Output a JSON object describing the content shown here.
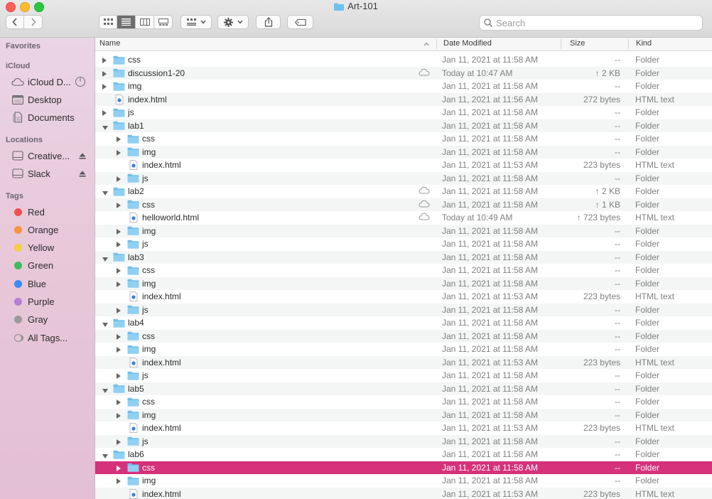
{
  "window": {
    "title": "Art-101",
    "search_placeholder": "Search"
  },
  "colors": {
    "selection": "#d6317b",
    "folder": "#6fc0ec",
    "sidebar_bg": "#e8c8d9"
  },
  "sidebar": {
    "favorites_label": "Favorites",
    "icloud_label": "iCloud",
    "icloud_items": [
      {
        "label": "iCloud D...",
        "icon": "cloud-icon"
      },
      {
        "label": "Desktop",
        "icon": "desktop-icon"
      },
      {
        "label": "Documents",
        "icon": "document-icon"
      }
    ],
    "locations_label": "Locations",
    "locations_items": [
      {
        "label": "Creative...",
        "icon": "drive-icon"
      },
      {
        "label": "Slack",
        "icon": "drive-icon"
      }
    ],
    "tags_label": "Tags",
    "tags": [
      {
        "label": "Red",
        "color": "#f0504f"
      },
      {
        "label": "Orange",
        "color": "#f5963f"
      },
      {
        "label": "Yellow",
        "color": "#f6cf42"
      },
      {
        "label": "Green",
        "color": "#3ebd5b"
      },
      {
        "label": "Blue",
        "color": "#3b8cf3"
      },
      {
        "label": "Purple",
        "color": "#b57ed9"
      },
      {
        "label": "Gray",
        "color": "#9a9a9a"
      },
      {
        "label": "All Tags...",
        "color": "none"
      }
    ]
  },
  "columns": {
    "name": "Name",
    "date": "Date Modified",
    "size": "Size",
    "kind": "Kind"
  },
  "rows": [
    {
      "name": "css",
      "level": 0,
      "type": "folder",
      "disclosure": "closed",
      "date": "Jan 11, 2021 at 11:58 AM",
      "size": "--",
      "kind": "Folder",
      "cloud": false
    },
    {
      "name": "discussion1-20",
      "level": 0,
      "type": "folder",
      "disclosure": "closed",
      "date": "Today at 10:47 AM",
      "size": "↑ 2 KB",
      "kind": "Folder",
      "cloud": true
    },
    {
      "name": "img",
      "level": 0,
      "type": "folder",
      "disclosure": "closed",
      "date": "Jan 11, 2021 at 11:58 AM",
      "size": "--",
      "kind": "Folder",
      "cloud": false
    },
    {
      "name": "index.html",
      "level": 0,
      "type": "file",
      "disclosure": "none",
      "date": "Jan 11, 2021 at 11:56 AM",
      "size": "272 bytes",
      "kind": "HTML text",
      "cloud": false
    },
    {
      "name": "js",
      "level": 0,
      "type": "folder",
      "disclosure": "closed",
      "date": "Jan 11, 2021 at 11:58 AM",
      "size": "--",
      "kind": "Folder",
      "cloud": false
    },
    {
      "name": "lab1",
      "level": 0,
      "type": "folder",
      "disclosure": "open",
      "date": "Jan 11, 2021 at 11:58 AM",
      "size": "--",
      "kind": "Folder",
      "cloud": false
    },
    {
      "name": "css",
      "level": 1,
      "type": "folder",
      "disclosure": "closed",
      "date": "Jan 11, 2021 at 11:58 AM",
      "size": "--",
      "kind": "Folder",
      "cloud": false
    },
    {
      "name": "img",
      "level": 1,
      "type": "folder",
      "disclosure": "closed",
      "date": "Jan 11, 2021 at 11:58 AM",
      "size": "--",
      "kind": "Folder",
      "cloud": false
    },
    {
      "name": "index.html",
      "level": 1,
      "type": "file",
      "disclosure": "none",
      "date": "Jan 11, 2021 at 11:53 AM",
      "size": "223 bytes",
      "kind": "HTML text",
      "cloud": false
    },
    {
      "name": "js",
      "level": 1,
      "type": "folder",
      "disclosure": "closed",
      "date": "Jan 11, 2021 at 11:58 AM",
      "size": "--",
      "kind": "Folder",
      "cloud": false
    },
    {
      "name": "lab2",
      "level": 0,
      "type": "folder",
      "disclosure": "open",
      "date": "Jan 11, 2021 at 11:58 AM",
      "size": "↑ 2 KB",
      "kind": "Folder",
      "cloud": true
    },
    {
      "name": "css",
      "level": 1,
      "type": "folder",
      "disclosure": "closed",
      "date": "Jan 11, 2021 at 11:58 AM",
      "size": "↑ 1 KB",
      "kind": "Folder",
      "cloud": true
    },
    {
      "name": "helloworld.html",
      "level": 1,
      "type": "file",
      "disclosure": "none",
      "date": "Today at 10:49 AM",
      "size": "↑ 723 bytes",
      "kind": "HTML text",
      "cloud": true
    },
    {
      "name": "img",
      "level": 1,
      "type": "folder",
      "disclosure": "closed",
      "date": "Jan 11, 2021 at 11:58 AM",
      "size": "--",
      "kind": "Folder",
      "cloud": false
    },
    {
      "name": "js",
      "level": 1,
      "type": "folder",
      "disclosure": "closed",
      "date": "Jan 11, 2021 at 11:58 AM",
      "size": "--",
      "kind": "Folder",
      "cloud": false
    },
    {
      "name": "lab3",
      "level": 0,
      "type": "folder",
      "disclosure": "open",
      "date": "Jan 11, 2021 at 11:58 AM",
      "size": "--",
      "kind": "Folder",
      "cloud": false
    },
    {
      "name": "css",
      "level": 1,
      "type": "folder",
      "disclosure": "closed",
      "date": "Jan 11, 2021 at 11:58 AM",
      "size": "--",
      "kind": "Folder",
      "cloud": false
    },
    {
      "name": "img",
      "level": 1,
      "type": "folder",
      "disclosure": "closed",
      "date": "Jan 11, 2021 at 11:58 AM",
      "size": "--",
      "kind": "Folder",
      "cloud": false
    },
    {
      "name": "index.html",
      "level": 1,
      "type": "file",
      "disclosure": "none",
      "date": "Jan 11, 2021 at 11:53 AM",
      "size": "223 bytes",
      "kind": "HTML text",
      "cloud": false
    },
    {
      "name": "js",
      "level": 1,
      "type": "folder",
      "disclosure": "closed",
      "date": "Jan 11, 2021 at 11:58 AM",
      "size": "--",
      "kind": "Folder",
      "cloud": false
    },
    {
      "name": "lab4",
      "level": 0,
      "type": "folder",
      "disclosure": "open",
      "date": "Jan 11, 2021 at 11:58 AM",
      "size": "--",
      "kind": "Folder",
      "cloud": false
    },
    {
      "name": "css",
      "level": 1,
      "type": "folder",
      "disclosure": "closed",
      "date": "Jan 11, 2021 at 11:58 AM",
      "size": "--",
      "kind": "Folder",
      "cloud": false
    },
    {
      "name": "img",
      "level": 1,
      "type": "folder",
      "disclosure": "closed",
      "date": "Jan 11, 2021 at 11:58 AM",
      "size": "--",
      "kind": "Folder",
      "cloud": false
    },
    {
      "name": "index.html",
      "level": 1,
      "type": "file",
      "disclosure": "none",
      "date": "Jan 11, 2021 at 11:53 AM",
      "size": "223 bytes",
      "kind": "HTML text",
      "cloud": false
    },
    {
      "name": "js",
      "level": 1,
      "type": "folder",
      "disclosure": "closed",
      "date": "Jan 11, 2021 at 11:58 AM",
      "size": "--",
      "kind": "Folder",
      "cloud": false
    },
    {
      "name": "lab5",
      "level": 0,
      "type": "folder",
      "disclosure": "open",
      "date": "Jan 11, 2021 at 11:58 AM",
      "size": "--",
      "kind": "Folder",
      "cloud": false
    },
    {
      "name": "css",
      "level": 1,
      "type": "folder",
      "disclosure": "closed",
      "date": "Jan 11, 2021 at 11:58 AM",
      "size": "--",
      "kind": "Folder",
      "cloud": false
    },
    {
      "name": "img",
      "level": 1,
      "type": "folder",
      "disclosure": "closed",
      "date": "Jan 11, 2021 at 11:58 AM",
      "size": "--",
      "kind": "Folder",
      "cloud": false
    },
    {
      "name": "index.html",
      "level": 1,
      "type": "file",
      "disclosure": "none",
      "date": "Jan 11, 2021 at 11:53 AM",
      "size": "223 bytes",
      "kind": "HTML text",
      "cloud": false
    },
    {
      "name": "js",
      "level": 1,
      "type": "folder",
      "disclosure": "closed",
      "date": "Jan 11, 2021 at 11:58 AM",
      "size": "--",
      "kind": "Folder",
      "cloud": false
    },
    {
      "name": "lab6",
      "level": 0,
      "type": "folder",
      "disclosure": "open",
      "date": "Jan 11, 2021 at 11:58 AM",
      "size": "--",
      "kind": "Folder",
      "cloud": false
    },
    {
      "name": "css",
      "level": 1,
      "type": "folder",
      "disclosure": "closed",
      "date": "Jan 11, 2021 at 11:58 AM",
      "size": "--",
      "kind": "Folder",
      "cloud": false,
      "selected": true
    },
    {
      "name": "img",
      "level": 1,
      "type": "folder",
      "disclosure": "closed",
      "date": "Jan 11, 2021 at 11:58 AM",
      "size": "--",
      "kind": "Folder",
      "cloud": false
    },
    {
      "name": "index.html",
      "level": 1,
      "type": "file",
      "disclosure": "none",
      "date": "Jan 11, 2021 at 11:53 AM",
      "size": "223 bytes",
      "kind": "HTML text",
      "cloud": false
    }
  ]
}
